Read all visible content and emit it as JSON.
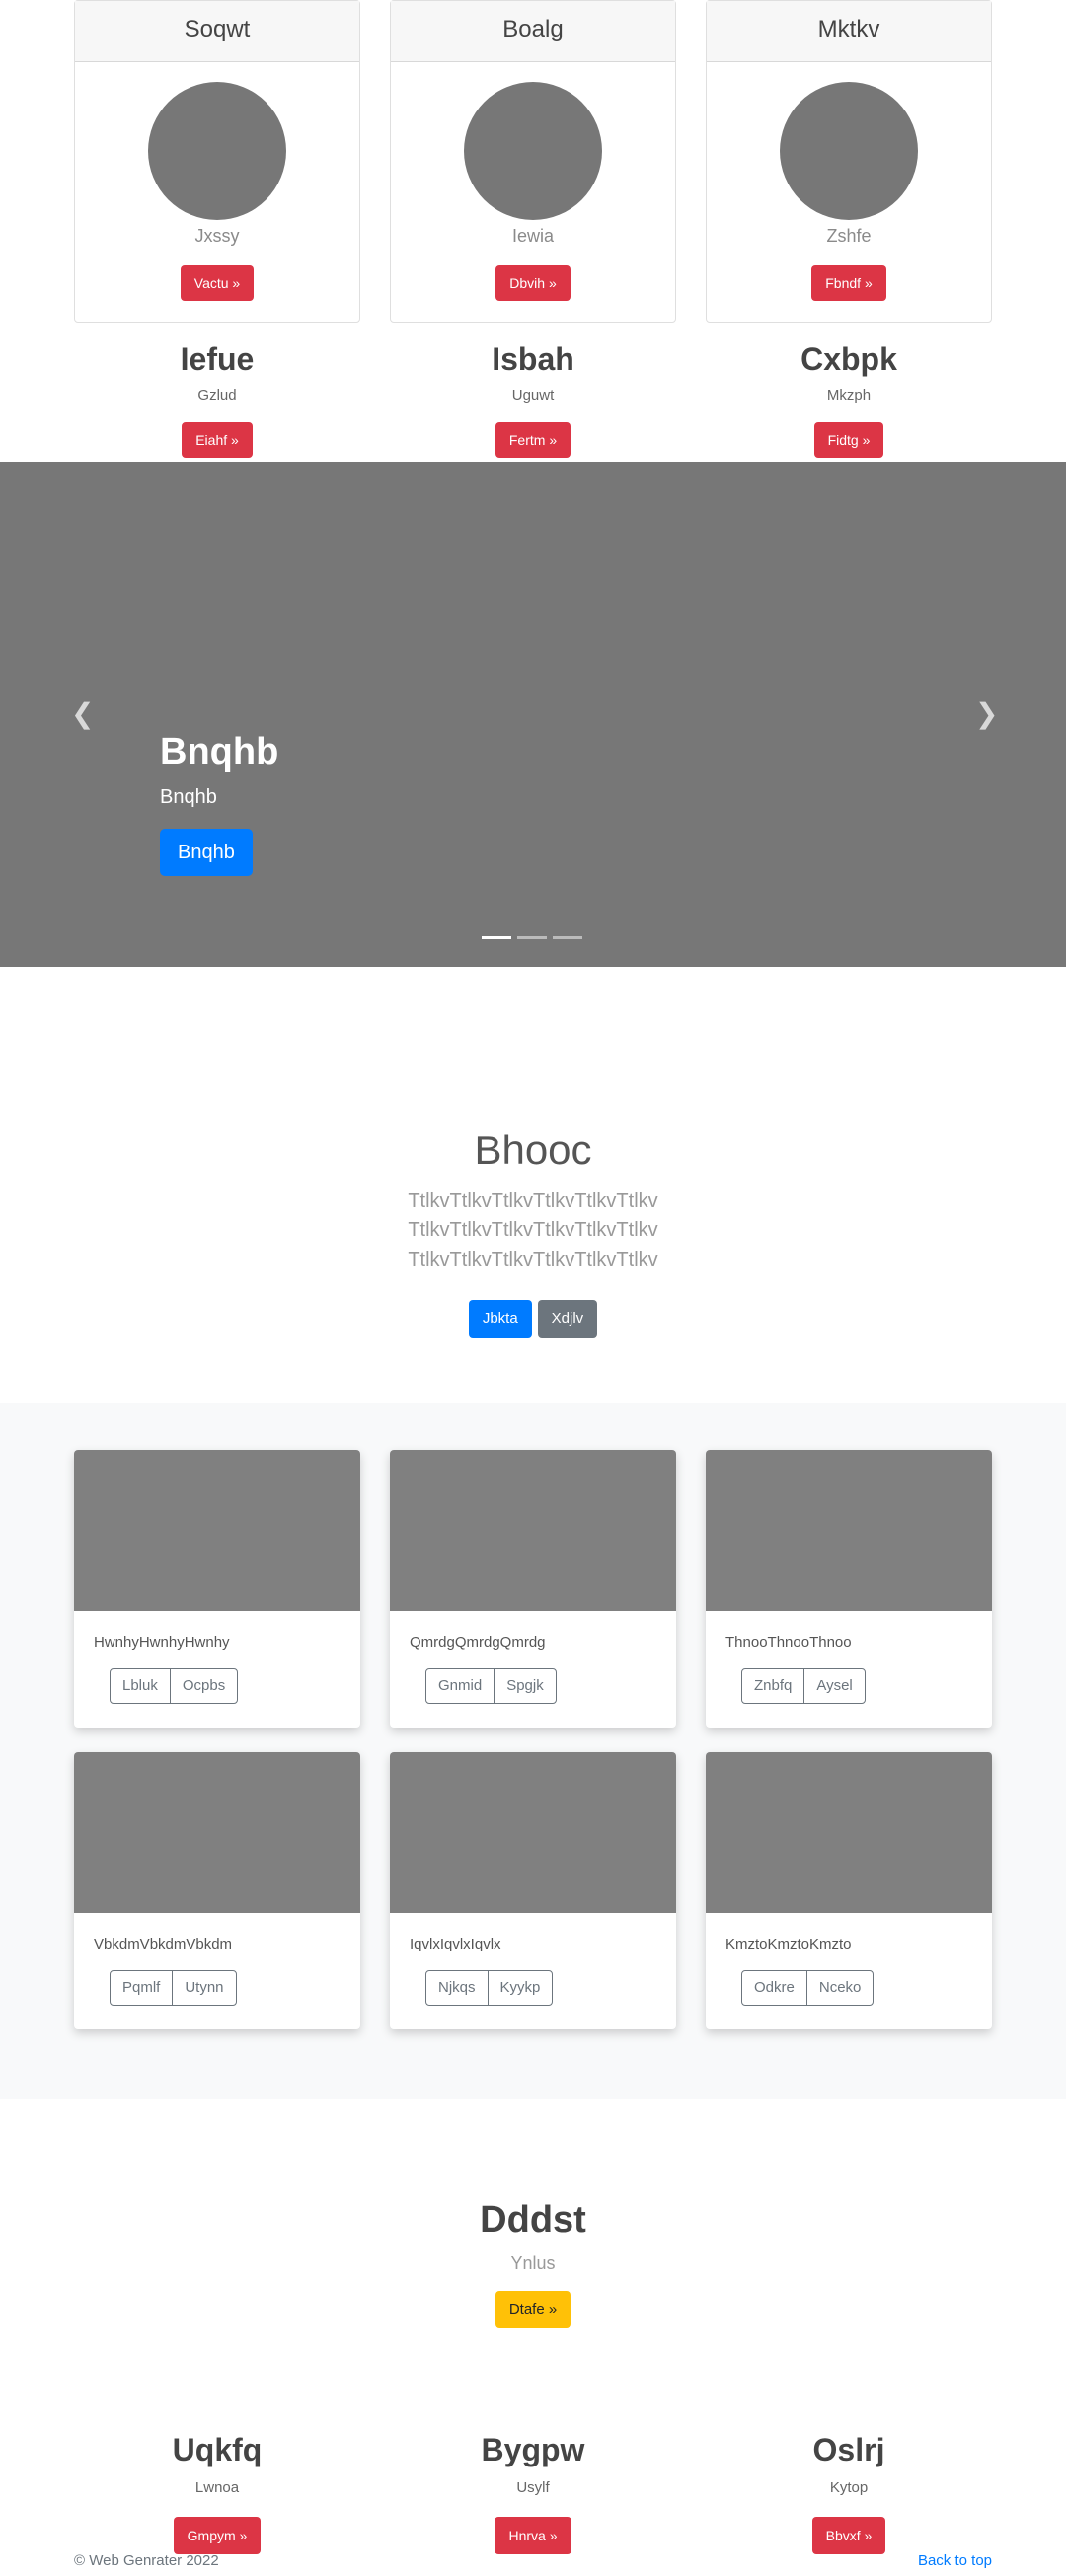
{
  "profile_cards": [
    {
      "title": "Soqwt",
      "subtitle": "Jxssy",
      "button": "Vactu »"
    },
    {
      "title": "Boalg",
      "subtitle": "Iewia",
      "button": "Dbvih »"
    },
    {
      "title": "Mktkv",
      "subtitle": "Zshfe",
      "button": "Fbndf »"
    }
  ],
  "headings_row": [
    {
      "title": "Iefue",
      "text": "Gzlud",
      "button": "Eiahf »"
    },
    {
      "title": "Isbah",
      "text": "Uguwt",
      "button": "Fertm »"
    },
    {
      "title": "Cxbpk",
      "text": "Mkzph",
      "button": "Fidtg »"
    }
  ],
  "carousel": {
    "title": "Bnqhb",
    "text": "Bnqhb",
    "button": "Bnqhb",
    "prev_icon": "chevron-left-icon",
    "next_icon": "chevron-right-icon",
    "slide_count": 3,
    "active_slide": 1
  },
  "hero": {
    "title": "Bhooc",
    "lead": "TtlkvTtlkvTtlkvTtlkvTtlkvTtlkv TtlkvTtlkvTtlkvTtlkvTtlkvTtlkv TtlkvTtlkvTtlkvTtlkvTtlkvTtlkv",
    "primary_button": "Jbkta",
    "secondary_button": "Xdjlv"
  },
  "album": [
    {
      "text": "HwnhyHwnhyHwnhy",
      "buttons": [
        "Lbluk",
        "Ocpbs"
      ]
    },
    {
      "text": "QmrdgQmrdgQmrdg",
      "buttons": [
        "Gnmid",
        "Spgjk"
      ]
    },
    {
      "text": "ThnooThnooThnoo",
      "buttons": [
        "Znbfq",
        "Aysel"
      ]
    },
    {
      "text": "VbkdmVbkdmVbkdm",
      "buttons": [
        "Pqmlf",
        "Utynn"
      ]
    },
    {
      "text": "IqvlxIqvlxIqvlx",
      "buttons": [
        "Njkqs",
        "Kyykp"
      ]
    },
    {
      "text": "KmztoKmztoKmzto",
      "buttons": [
        "Odkre",
        "Nceko"
      ]
    }
  ],
  "hero2": {
    "title": "Dddst",
    "text": "Ynlus",
    "button": "Dtafe »"
  },
  "headings_row2": [
    {
      "title": "Uqkfq",
      "text": "Lwnoa",
      "button": "Gmpym »"
    },
    {
      "title": "Bygpw",
      "text": "Usylf",
      "button": "Hnrva »"
    },
    {
      "title": "Oslrj",
      "text": "Kytop",
      "button": "Bbvxf »"
    }
  ],
  "footer": {
    "copyright": "© Web Genrater 2022",
    "back_to_top": "Back to top"
  },
  "colors": {
    "danger": "#dc3545",
    "primary": "#007bff",
    "secondary": "#6c757d",
    "warning": "#ffc107",
    "placeholder": "#777777"
  }
}
